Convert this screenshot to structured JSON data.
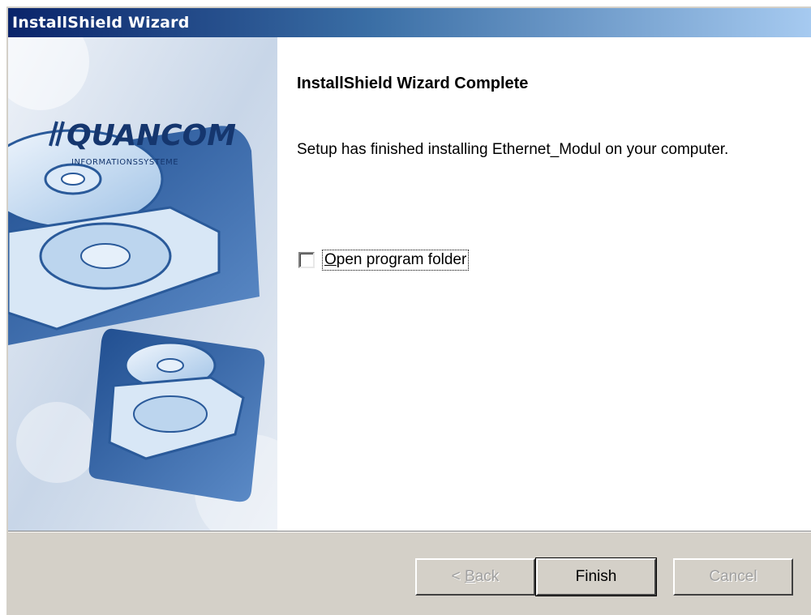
{
  "window": {
    "title": "InstallShield Wizard"
  },
  "banner": {
    "logo_text": "QUANCOM",
    "logo_subtext": "INFORMATIONSSYSTEME"
  },
  "content": {
    "heading": "InstallShield Wizard Complete",
    "message": "Setup has finished installing Ethernet_Modul on your computer.",
    "checkbox": {
      "label": "Open program folder",
      "checked": false
    }
  },
  "buttons": {
    "back_prefix": "< ",
    "back_accel": "B",
    "back_rest": "ack",
    "finish": "Finish",
    "cancel": "Cancel"
  },
  "colors": {
    "titlebar_start": "#0a246a",
    "titlebar_end": "#a6caf0",
    "footer": "#d4d0c8"
  }
}
